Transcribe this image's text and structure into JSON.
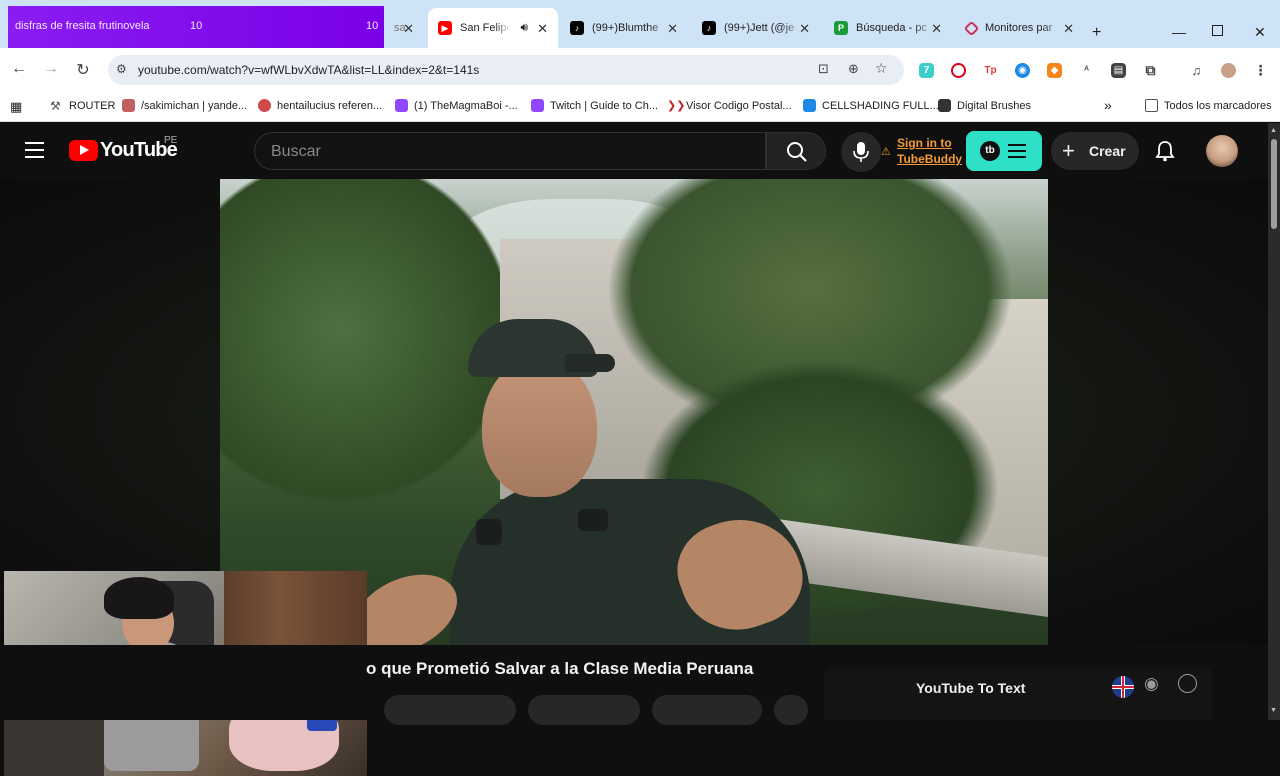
{
  "overlay": {
    "text": "disfras de fresita frutinovela",
    "num_a": "10",
    "num_b": "10"
  },
  "tabs": [
    {
      "title": "San Felipe",
      "active": true,
      "icon": "youtube-icon",
      "color": "#ff0000"
    },
    {
      "title": "(99+)Blumthe",
      "active": false,
      "icon": "tiktok-icon",
      "color": "#000000"
    },
    {
      "title": "(99+)Jett (@je",
      "active": false,
      "icon": "tiktok-icon",
      "color": "#000000"
    },
    {
      "title": "Búsqueda - pc",
      "active": false,
      "icon": "pc-icon",
      "color": "#1a9c3a"
    },
    {
      "title": "Monitores par",
      "active": false,
      "icon": "monitor-icon",
      "color": "#d12f5b"
    }
  ],
  "partial_tab_fragment": "sa",
  "address_bar": {
    "url": "youtube.com/watch?v=wfWLbvXdwTA&list=LL&index=2&t=141s"
  },
  "bookmarks": [
    {
      "label": "ROUTER",
      "color": "#555555"
    },
    {
      "label": "/sakimichan | yande...",
      "color": "#c06060"
    },
    {
      "label": "hentailucius referen...",
      "color": "#d04a4a"
    },
    {
      "label": "(1) TheMagmaBoi -...",
      "color": "#9146ff"
    },
    {
      "label": "Twitch | Guide to Ch...",
      "color": "#9146ff"
    },
    {
      "label": "Visor Codigo Postal...",
      "color": "#c8202a"
    },
    {
      "label": "CELLSHADING FULL...",
      "color": "#1e88e5"
    },
    {
      "label": "Digital Brushes",
      "color": "#333333"
    }
  ],
  "bookmarks_more": "»",
  "all_bookmarks": "Todos los marcadores",
  "youtube": {
    "logo_text": "YouTube",
    "region": "PE",
    "search_placeholder": "Buscar",
    "tubebuddy_signin_line1": "Sign in to",
    "tubebuddy_signin_line2": "TubeBuddy",
    "create_label": "Crear",
    "video_title": "o que Prometió Salvar a la Clase Media Peruana",
    "yt_to_text_label": "YouTube To Text"
  }
}
